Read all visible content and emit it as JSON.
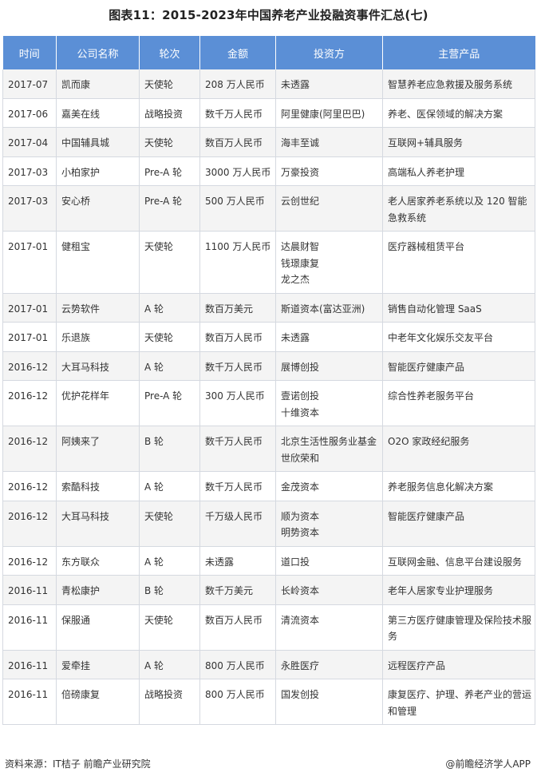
{
  "title": "图表11：2015-2023年中国养老产业投融资事件汇总(七)",
  "headers": [
    "时间",
    "公司名称",
    "轮次",
    "金额",
    "投资方",
    "主营产品"
  ],
  "rows": [
    {
      "time": "2017-07",
      "company": "凯而康",
      "round": "天使轮",
      "amount": "208 万人民币",
      "investors": [
        "未透露"
      ],
      "product": "智慧养老应急救援及服务系统"
    },
    {
      "time": "2017-06",
      "company": "嘉美在线",
      "round": "战略投资",
      "amount": "数千万人民币",
      "investors": [
        "阿里健康(阿里巴巴)"
      ],
      "product": "养老、医保领域的解决方案"
    },
    {
      "time": "2017-04",
      "company": "中国辅具城",
      "round": "天使轮",
      "amount": "数百万人民币",
      "investors": [
        "海丰至诚"
      ],
      "product": "互联网+辅具服务"
    },
    {
      "time": "2017-03",
      "company": "小柏家护",
      "round": "Pre-A 轮",
      "amount": "3000 万人民币",
      "investors": [
        "万豪投资"
      ],
      "product": "高端私人养老护理"
    },
    {
      "time": "2017-03",
      "company": "安心桥",
      "round": "Pre-A 轮",
      "amount": "500 万人民币",
      "investors": [
        "云创世纪"
      ],
      "product": "老人居家养老系统以及 120 智能急救系统"
    },
    {
      "time": "2017-01",
      "company": "健租宝",
      "round": "天使轮",
      "amount": "1100 万人民币",
      "investors": [
        "达晨财智",
        "钱璟康复",
        "龙之杰"
      ],
      "product": "医疗器械租赁平台"
    },
    {
      "time": "2017-01",
      "company": "云势软件",
      "round": "A 轮",
      "amount": "数百万美元",
      "investors": [
        "斯道资本(富达亚洲)"
      ],
      "product": "销售自动化管理 SaaS"
    },
    {
      "time": "2017-01",
      "company": "乐退族",
      "round": "天使轮",
      "amount": "数百万人民币",
      "investors": [
        "未透露"
      ],
      "product": "中老年文化娱乐交友平台"
    },
    {
      "time": "2016-12",
      "company": "大耳马科技",
      "round": "A 轮",
      "amount": "数千万人民币",
      "investors": [
        "展博创投"
      ],
      "product": "智能医疗健康产品"
    },
    {
      "time": "2016-12",
      "company": "优护花样年",
      "round": "Pre-A 轮",
      "amount": "300 万人民币",
      "investors": [
        "壹诺创投",
        "十维资本"
      ],
      "product": "综合性养老服务平台"
    },
    {
      "time": "2016-12",
      "company": "阿姨来了",
      "round": "B 轮",
      "amount": "数千万人民币",
      "investors": [
        "北京生活性服务业基金",
        "世欣荣和"
      ],
      "product": "O2O 家政经纪服务"
    },
    {
      "time": "2016-12",
      "company": "索酷科技",
      "round": "A 轮",
      "amount": "数千万人民币",
      "investors": [
        "金茂资本"
      ],
      "product": "养老服务信息化解决方案"
    },
    {
      "time": "2016-12",
      "company": "大耳马科技",
      "round": "天使轮",
      "amount": "千万级人民币",
      "investors": [
        "顺为资本",
        "明势资本"
      ],
      "product": "智能医疗健康产品"
    },
    {
      "time": "2016-12",
      "company": "东方联众",
      "round": "A 轮",
      "amount": "未透露",
      "investors": [
        "道口投"
      ],
      "product": "互联网金融、信息平台建设服务"
    },
    {
      "time": "2016-11",
      "company": "青松康护",
      "round": "B 轮",
      "amount": "数千万美元",
      "investors": [
        "长岭资本"
      ],
      "product": "老年人居家专业护理服务"
    },
    {
      "time": "2016-11",
      "company": "保服通",
      "round": "天使轮",
      "amount": "数百万人民币",
      "investors": [
        "清流资本"
      ],
      "product": "第三方医疗健康管理及保险技术服务"
    },
    {
      "time": "2016-11",
      "company": "爱牵挂",
      "round": "A 轮",
      "amount": "800 万人民币",
      "investors": [
        "永胜医疗"
      ],
      "product": "远程医疗产品"
    },
    {
      "time": "2016-11",
      "company": "倍磅康复",
      "round": "战略投资",
      "amount": "800 万人民币",
      "investors": [
        "国发创投"
      ],
      "product": "康复医疗、护理、养老产业的营运和管理"
    }
  ],
  "footer": {
    "source": "资料来源：IT桔子 前瞻产业研究院",
    "brand": "@前瞻经济学人APP"
  }
}
